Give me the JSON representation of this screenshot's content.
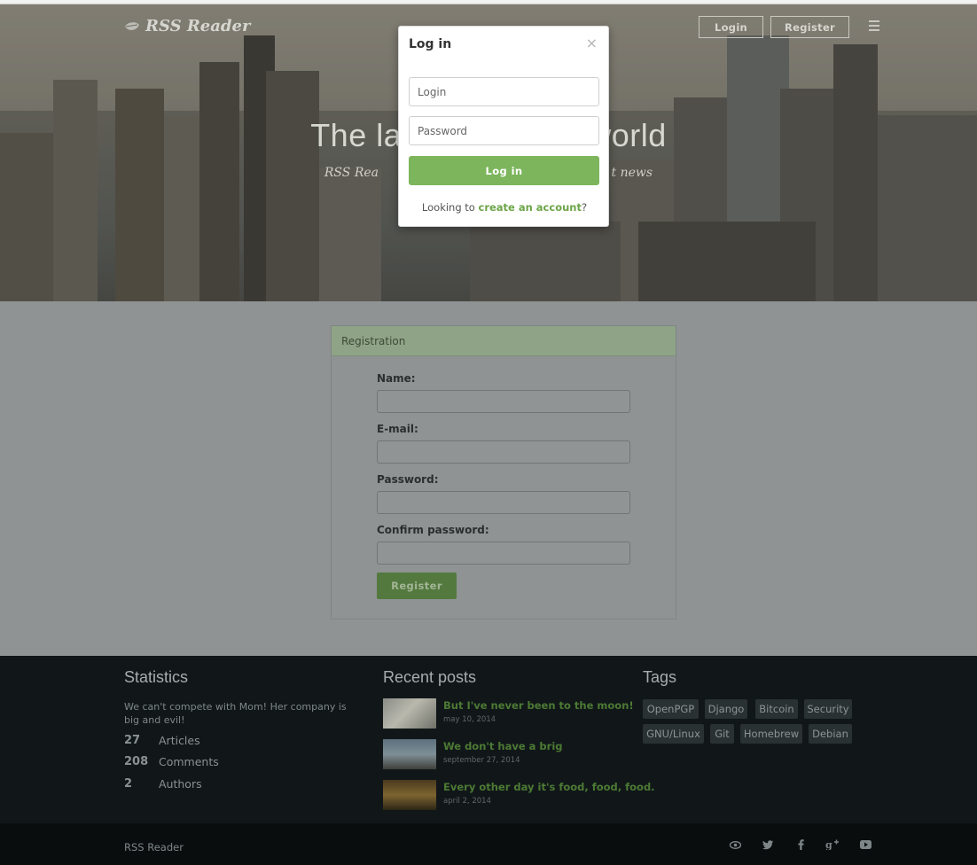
{
  "brand": {
    "name": "RSS Reader"
  },
  "nav": {
    "login_label": "Login",
    "register_label": "Register"
  },
  "hero": {
    "title": "The la                    world",
    "subtitle": "RSS Rea                                                           t news"
  },
  "modal": {
    "title": "Log in",
    "close": "×",
    "login_placeholder": "Login",
    "password_placeholder": "Password",
    "submit_label": "Log in",
    "footer_prefix": "Looking to ",
    "footer_link": "create an account",
    "footer_suffix": "?"
  },
  "registration": {
    "title": "Registration",
    "fields": [
      {
        "label": "Name:"
      },
      {
        "label": "E-mail:"
      },
      {
        "label": "Password:"
      },
      {
        "label": "Confirm password:"
      }
    ],
    "submit_label": "Register"
  },
  "footer": {
    "statistics": {
      "title": "Statistics",
      "text": "We can't compete with Mom! Her company is big and evil!",
      "items": [
        {
          "value": "27",
          "label": "Articles"
        },
        {
          "value": "208",
          "label": "Comments"
        },
        {
          "value": "2",
          "label": "Authors"
        }
      ]
    },
    "recent_posts": {
      "title": "Recent posts",
      "items": [
        {
          "title": "But I've never been to the moon!",
          "date": "may 10, 2014"
        },
        {
          "title": "We don't have a brig",
          "date": "september 27, 2014"
        },
        {
          "title": "Every other day it's food, food, food.",
          "date": "april 2, 2014"
        }
      ]
    },
    "tags": {
      "title": "Tags",
      "items": [
        "OpenPGP",
        "Django",
        "Bitcoin",
        "Security",
        "GNU/Linux",
        "Git",
        "Homebrew",
        "Debian"
      ]
    }
  },
  "bottom": {
    "brand": "RSS Reader",
    "social": [
      "eye-icon",
      "twitter-icon",
      "facebook-icon",
      "google-plus-icon",
      "youtube-icon"
    ]
  }
}
